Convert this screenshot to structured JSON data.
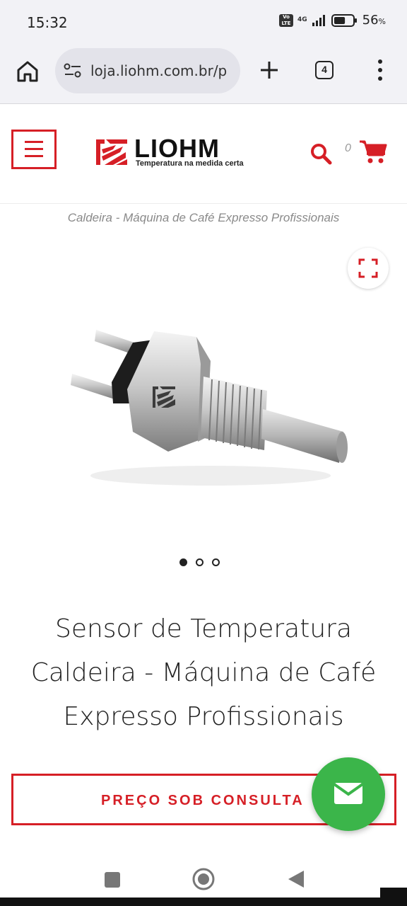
{
  "status_bar": {
    "time": "15:32",
    "volte": "Vo LTE",
    "network": "4G",
    "battery_percent": "56",
    "battery_suffix": "%",
    "battery_level": 0.56
  },
  "browser": {
    "url": "loja.liohm.com.br/p",
    "tab_count": "4",
    "icons": [
      "home-icon",
      "site-settings-icon",
      "plus-icon",
      "tabs-icon",
      "overflow-menu-icon"
    ]
  },
  "header": {
    "logo_word": "LIOHM",
    "logo_tagline": "Temperatura na medida certa",
    "cart_count": "0",
    "icons": [
      "hamburger-menu-icon",
      "search-icon",
      "cart-icon"
    ]
  },
  "breadcrumb": "Caldeira - Máquina de Café Expresso Profissionais",
  "gallery": {
    "dot_count": 3,
    "active_index": 0
  },
  "product": {
    "title": "Sensor de Temperatura Caldeira - Máquina de Café Expresso Profissionais",
    "price_button": "PREÇO SOB CONSULTA"
  },
  "colors": {
    "brand_red": "#d61f26",
    "fab_green": "#3bb54a"
  }
}
